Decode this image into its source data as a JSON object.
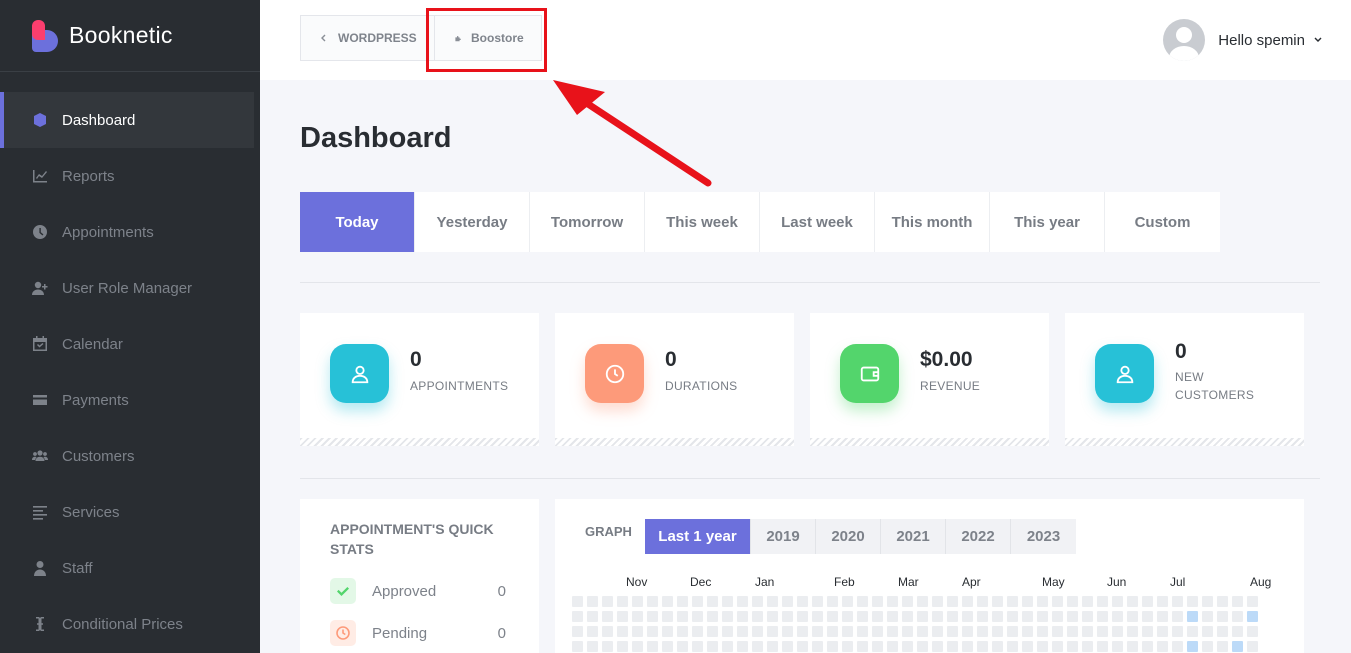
{
  "brand": {
    "name": "Booknetic"
  },
  "sidebar": {
    "items": [
      {
        "label": "Dashboard",
        "icon": "cube-icon",
        "active": true
      },
      {
        "label": "Reports",
        "icon": "chart-line-icon"
      },
      {
        "label": "Appointments",
        "icon": "clock-icon"
      },
      {
        "label": "User Role Manager",
        "icon": "user-plus-icon"
      },
      {
        "label": "Calendar",
        "icon": "calendar-icon"
      },
      {
        "label": "Payments",
        "icon": "credit-card-icon"
      },
      {
        "label": "Customers",
        "icon": "users-icon"
      },
      {
        "label": "Services",
        "icon": "list-icon"
      },
      {
        "label": "Staff",
        "icon": "user-icon"
      },
      {
        "label": "Conditional Prices",
        "icon": "i-cursor-icon"
      }
    ]
  },
  "topbar": {
    "breadcrumb_wordpress": "WORDPRESS",
    "breadcrumb_boostore": "Boostore",
    "user_greeting": "Hello spemin"
  },
  "page": {
    "title": "Dashboard"
  },
  "tabs": [
    "Today",
    "Yesterday",
    "Tomorrow",
    "This week",
    "Last week",
    "This month",
    "This year",
    "Custom"
  ],
  "active_tab": "Today",
  "stats": [
    {
      "value": "0",
      "label": "APPOINTMENTS",
      "color": "#27c1d7",
      "icon": "user-icon"
    },
    {
      "value": "0",
      "label": "DURATIONS",
      "color": "#fd9a7a",
      "icon": "clock-icon"
    },
    {
      "value": "$0.00",
      "label": "REVENUE",
      "color": "#53d56c",
      "icon": "wallet-icon"
    },
    {
      "value": "0",
      "label": "NEW CUSTOMERS",
      "color": "#27c1d7",
      "icon": "user-icon"
    }
  ],
  "quick_stats": {
    "title": "APPOINTMENT'S QUICK STATS",
    "items": [
      {
        "label": "Approved",
        "count": "0",
        "icon": "check-icon",
        "color": "#53d56c"
      },
      {
        "label": "Pending",
        "count": "0",
        "icon": "clock-icon",
        "color": "#fd9a7a"
      }
    ]
  },
  "graph": {
    "title": "GRAPH",
    "tabs": [
      "Last 1 year",
      "2019",
      "2020",
      "2021",
      "2022",
      "2023"
    ],
    "active_tab": "Last 1 year",
    "months": [
      "Nov",
      "Dec",
      "Jan",
      "Feb",
      "Mar",
      "Apr",
      "May",
      "Jun",
      "Jul",
      "Aug"
    ]
  },
  "colors": {
    "accent": "#6c70dc",
    "sidebar_bg": "#292d32",
    "highlight_red": "#e8121a"
  }
}
